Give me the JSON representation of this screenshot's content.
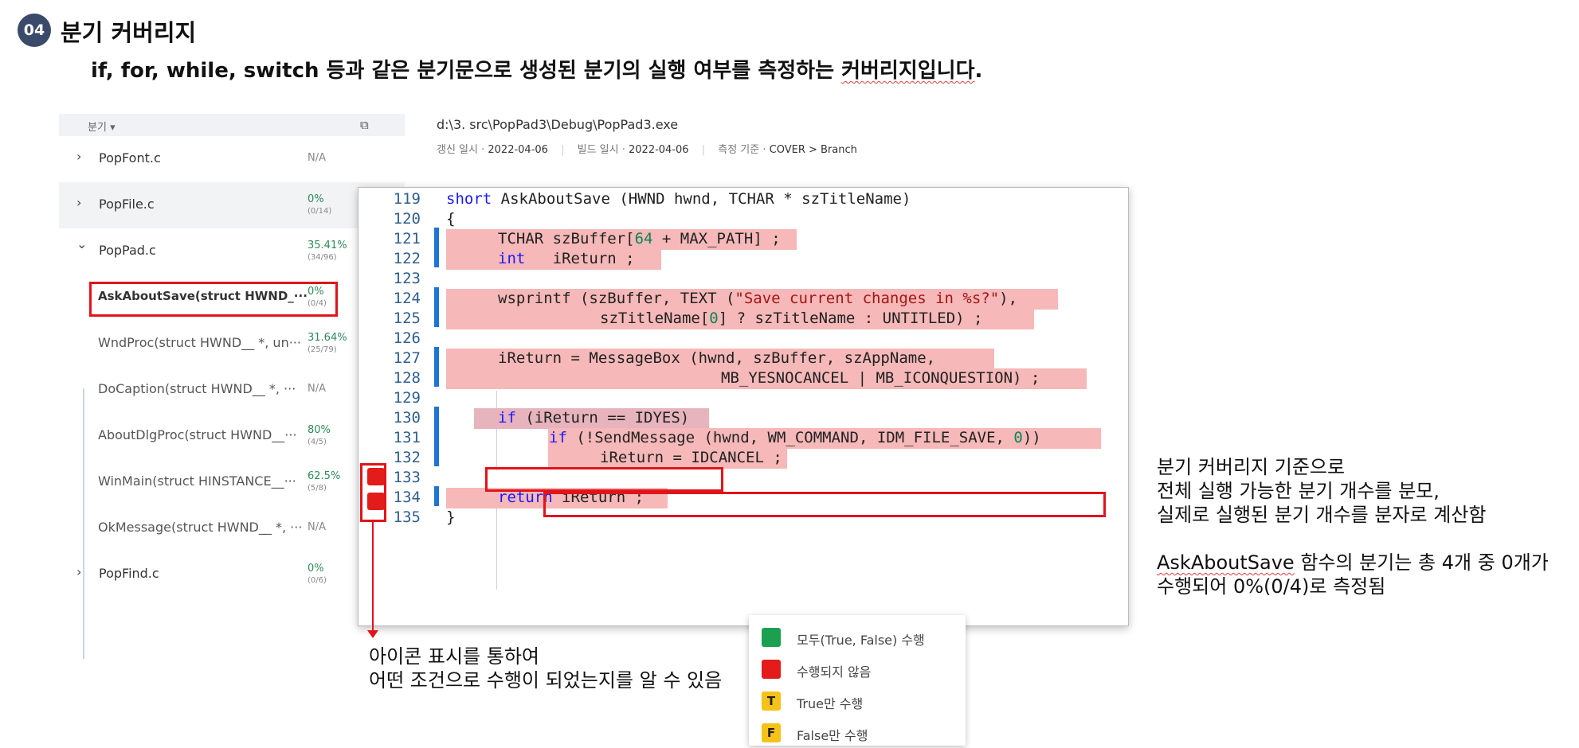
{
  "header": {
    "badge": "04",
    "title": "분기 커버리지",
    "subtitle_pre": "if, for, while, switch 등과 같은 분기문으로 생성된 분기의 실행 여부를 측정하는 ",
    "subtitle_squig": "커버리지입니다",
    "subtitle_post": "."
  },
  "tree": {
    "header_label": "분기",
    "header_arrow": "▾",
    "copy_icon": "⧉",
    "rows": [
      {
        "name": "PopFont.c",
        "chev": "›",
        "pct": "N/A",
        "frac": ""
      },
      {
        "name": "PopFile.c",
        "chev": "›",
        "pct": "0%",
        "frac": "(0/14)"
      },
      {
        "name": "PopPad.c",
        "chev": "⌄",
        "pct": "35.41%",
        "frac": "(34/96)"
      },
      {
        "name": "AskAboutSave(struct HWND_···",
        "pct": "0%",
        "frac": "(0/4)"
      },
      {
        "name": "WndProc(struct HWND__ *, un···",
        "pct": "31.64%",
        "frac": "(25/79)"
      },
      {
        "name": "DoCaption(struct HWND__ *, ···",
        "pct": "N/A",
        "frac": ""
      },
      {
        "name": "AboutDlgProc(struct HWND__···",
        "pct": "80%",
        "frac": "(4/5)"
      },
      {
        "name": "WinMain(struct HINSTANCE__···",
        "pct": "62.5%",
        "frac": "(5/8)"
      },
      {
        "name": "OkMessage(struct HWND__ *, ···",
        "pct": "N/A",
        "frac": ""
      },
      {
        "name": "PopFind.c",
        "chev": "›",
        "pct": "0%",
        "frac": "(0/6)"
      }
    ]
  },
  "info": {
    "path": "d:\\3. src\\PopPad3\\Debug\\PopPad3.exe",
    "renewed_label": "갱신 일시 ·",
    "renewed_value": "2022-04-06",
    "build_label": "빌드 일시 ·",
    "build_value": "2022-04-06",
    "criteria_label": "측정 기준 ·",
    "criteria_value": "COVER > Branch"
  },
  "code": {
    "line_numbers": [
      "119",
      "120",
      "121",
      "122",
      "123",
      "124",
      "125",
      "126",
      "127",
      "128",
      "129",
      "130",
      "131",
      "132",
      "133",
      "134",
      "135"
    ],
    "l119_kw": "short",
    "l119_rest": " AskAboutSave (HWND hwnd, TCHAR * szTitleName)",
    "l120": "{",
    "l121_a": "TCHAR szBuffer[",
    "l121_num": "64",
    "l121_b": " + MAX_PATH] ;",
    "l122_kw": "int",
    "l122_rest": "   iReturn ;",
    "l124_a": "wsprintf (szBuffer, TEXT (",
    "l124_str": "\"Save current changes in %s?\"",
    "l124_b": "),",
    "l125_a": "szTitleName[",
    "l125_num": "0",
    "l125_b": "] ? szTitleName : UNTITLED) ;",
    "l127": "iReturn = MessageBox (hwnd, szBuffer, szAppName,",
    "l128": "MB_YESNOCANCEL | MB_ICONQUESTION) ;",
    "l130_kw": "if",
    "l130_rest": " (iReturn == IDYES)",
    "l131_kw": "if",
    "l131_a": " (!SendMessage (hwnd, WM_COMMAND, IDM_FILE_SAVE, ",
    "l131_num": "0",
    "l131_b": "))",
    "l132": "iReturn = IDCANCEL ;",
    "l134_kw": "return",
    "l134_rest": " iReturn ;",
    "l135": "}"
  },
  "callouts": {
    "icon_note_1": "아이콘 표시를 통하여",
    "icon_note_2": "어떤 조건으로 수행이 되었는지를  알 수 있음",
    "right_1": "분기 커버리지 기준으로",
    "right_2": "전체 실행 가능한 분기 개수를 분모,",
    "right_3": "실제로 실행된 분기 개수를 분자로 계산함",
    "right_4_squig": "AskAboutSave",
    "right_4_rest": " 함수의 분기는 총 4개 중 0개가",
    "right_5": "수행되어 0%(0/4)로 측정됨"
  },
  "legend": {
    "items": [
      {
        "label": "모두(True, False) 수행",
        "color": "#1aa04f",
        "glyph": ""
      },
      {
        "label": "수행되지 않음",
        "color": "#e31b1b",
        "glyph": ""
      },
      {
        "label": "True만 수행",
        "color": "#f5c21a",
        "glyph": "T"
      },
      {
        "label": "False만 수행",
        "color": "#f5c21a",
        "glyph": "F"
      }
    ]
  },
  "colors": {
    "accent_red": "#e0141a",
    "coverage_green": "#2e8b57",
    "highlight_pink": "#f6b8b8",
    "line_marker_blue": "#1e73d6",
    "badge_navy": "#3a4a6b"
  }
}
